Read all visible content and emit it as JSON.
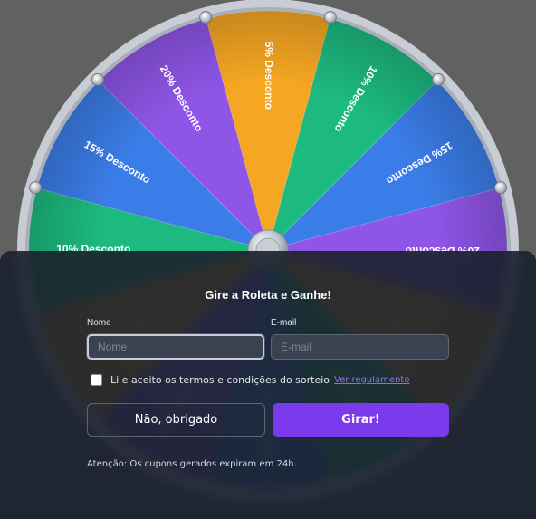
{
  "wheel": {
    "segments": [
      {
        "label": "5% Desconto",
        "color": "#f5a623"
      },
      {
        "label": "10% Desconto",
        "color": "#1db97f"
      },
      {
        "label": "15% Desconto",
        "color": "#3b7de8"
      },
      {
        "label": "20% Desconto",
        "color": "#8e55e6"
      },
      {
        "label": "5% Desconto",
        "color": "#f5a623"
      },
      {
        "label": "10% Desconto",
        "color": "#1db97f"
      },
      {
        "label": "15% Desconto",
        "color": "#3b7de8"
      },
      {
        "label": "20% Desconto",
        "color": "#8e55e6"
      },
      {
        "label": "5% Desconto",
        "color": "#f5a623"
      },
      {
        "label": "10% Desconto",
        "color": "#1db97f"
      },
      {
        "label": "15% Desconto",
        "color": "#3b7de8"
      },
      {
        "label": "20% Desconto",
        "color": "#8e55e6"
      }
    ],
    "rim_color": "#c8ccd4"
  },
  "form": {
    "title": "Gire a Roleta e Ganhe!",
    "name_label": "Nome",
    "name_placeholder": "Nome",
    "email_label": "E-mail",
    "email_placeholder": "E-mail",
    "consent_text": "Li e aceito os termos e condições do sorteio",
    "consent_link": "Ver regulamento",
    "decline_label": "Não, obrigado",
    "spin_label": "Girar!",
    "notice": "Atenção: Os cupons gerados expiram em 24h."
  },
  "colors": {
    "accent": "#7c3aed",
    "link": "#8e6ee8",
    "panel": "#1a202c"
  }
}
